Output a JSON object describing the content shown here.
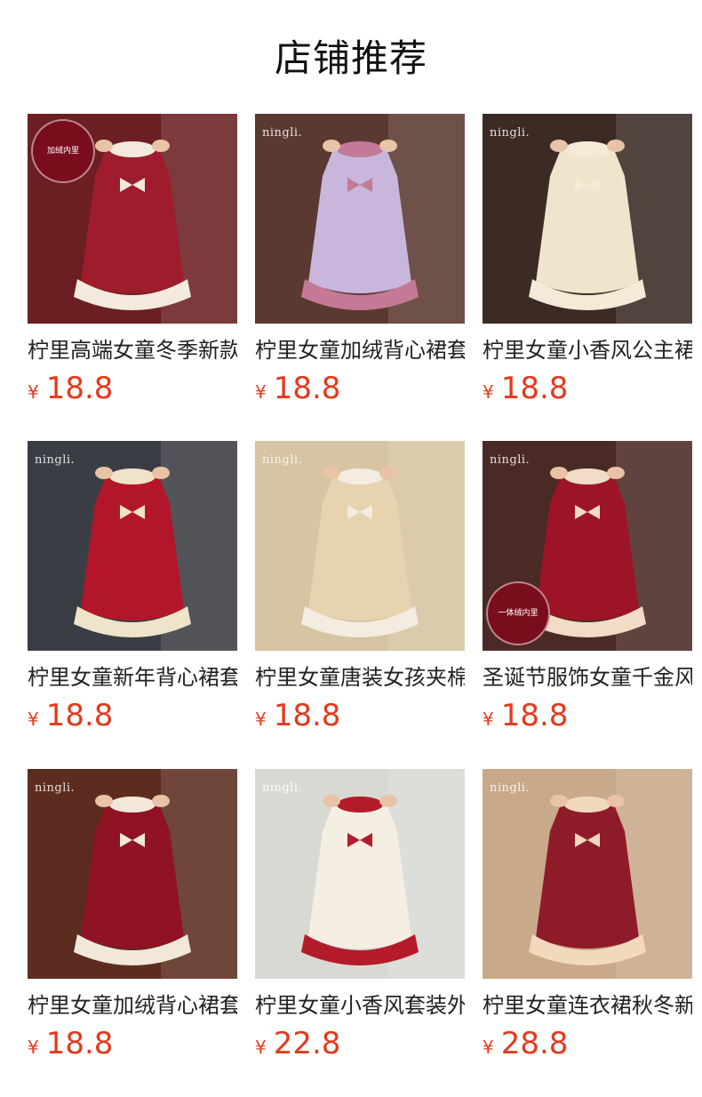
{
  "header": {
    "title": "店铺推荐"
  },
  "products": [
    {
      "title": "柠里高端女童冬季新款",
      "currency": "¥",
      "price": "18.8",
      "brand": "ningli.",
      "badge": "加绒内里",
      "badge_pos": "top",
      "bg": "#6b1f22",
      "accent": "#9e1c2c",
      "fur": "#f3e9dc"
    },
    {
      "title": "柠里女童加绒背心裙套装",
      "currency": "¥",
      "price": "18.8",
      "brand": "ningli.",
      "badge": "",
      "badge_pos": "",
      "bg": "#5a3a30",
      "accent": "#c9b6dc",
      "fur": "#c47a96"
    },
    {
      "title": "柠里女童小香风公主裙",
      "currency": "¥",
      "price": "18.8",
      "brand": "ningli.",
      "badge": "",
      "badge_pos": "",
      "bg": "#3c2a24",
      "accent": "#efe4cc",
      "fur": "#f3ead7"
    },
    {
      "title": "柠里女童新年背心裙套装",
      "currency": "¥",
      "price": "18.8",
      "brand": "ningli.",
      "badge": "",
      "badge_pos": "",
      "bg": "#3b3d44",
      "accent": "#b3162a",
      "fur": "#efe3c9"
    },
    {
      "title": "柠里女童唐装女孩夹棉",
      "currency": "¥",
      "price": "18.8",
      "brand": "ningli.",
      "badge": "",
      "badge_pos": "",
      "bg": "#d6c4a2",
      "accent": "#e8d3b0",
      "fur": "#f4ece0"
    },
    {
      "title": "圣诞节服饰女童千金风",
      "currency": "¥",
      "price": "18.8",
      "brand": "ningli.",
      "badge": "一体绒内里",
      "badge_pos": "bottom",
      "bg": "#4a2a24",
      "accent": "#9d1426",
      "fur": "#f2dcc6"
    },
    {
      "title": "柠里女童加绒背心裙套装",
      "currency": "¥",
      "price": "18.8",
      "brand": "ningli.",
      "badge": "",
      "badge_pos": "",
      "bg": "#5c2d1e",
      "accent": "#8f1322",
      "fur": "#f2e8da"
    },
    {
      "title": "柠里女童小香风套装外套",
      "currency": "¥",
      "price": "22.8",
      "brand": "ningli.",
      "badge": "",
      "badge_pos": "",
      "bg": "#d9d9d4",
      "accent": "#f5efe3",
      "fur": "#b41c2b"
    },
    {
      "title": "柠里女童连衣裙秋冬新款",
      "currency": "¥",
      "price": "28.8",
      "brand": "ningli.",
      "badge": "",
      "badge_pos": "",
      "bg": "#c9a98a",
      "accent": "#8e1b2a",
      "fur": "#f2d9bd"
    }
  ]
}
